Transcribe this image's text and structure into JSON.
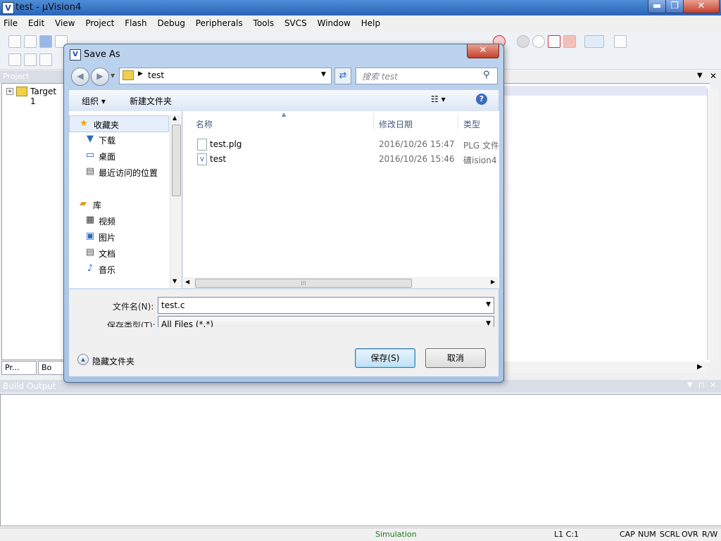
{
  "window": {
    "title": "test  - µVision4",
    "min_label": "▬",
    "max_label": "❐",
    "close_label": "✕"
  },
  "menu": [
    "File",
    "Edit",
    "View",
    "Project",
    "Flash",
    "Debug",
    "Peripherals",
    "Tools",
    "SVCS",
    "Window",
    "Help"
  ],
  "project": {
    "header": "Project",
    "tree_item": "Target 1",
    "tabs": [
      "Pr...",
      "Bo"
    ]
  },
  "build": {
    "header": "Build Output"
  },
  "status": {
    "mode": "Simulation",
    "position": "L1 C:1",
    "indicators": [
      "CAP",
      "NUM",
      "SCRL",
      "OVR",
      "R/W"
    ]
  },
  "dialog": {
    "title": "Save As",
    "address": "test",
    "search_placeholder": "搜索 test",
    "organize_label": "组织 ▾",
    "new_folder_label": "新建文件夹",
    "view_label": "☷ ▾",
    "help_label": "?",
    "nav": {
      "favorites": "收藏夹",
      "favorites_items": [
        "下载",
        "桌面",
        "最近访问的位置"
      ],
      "libraries": "库",
      "libraries_items": [
        "视频",
        "图片",
        "文档",
        "音乐"
      ]
    },
    "columns": {
      "name": "名称",
      "date": "修改日期",
      "type": "类型"
    },
    "files": [
      {
        "name": "test.plg",
        "date": "2016/10/26 15:47",
        "type": "PLG 文件"
      },
      {
        "name": "test",
        "date": "2016/10/26 15:46",
        "type": "礦ision4"
      }
    ],
    "filename_label": "文件名(N):",
    "filename_value": "test.c",
    "filetype_label": "保存类型(T):",
    "filetype_value": "All Files (*.*)",
    "hide_folders_label": "隐藏文件夹",
    "save_label": "保存(S)",
    "cancel_label": "取消"
  }
}
